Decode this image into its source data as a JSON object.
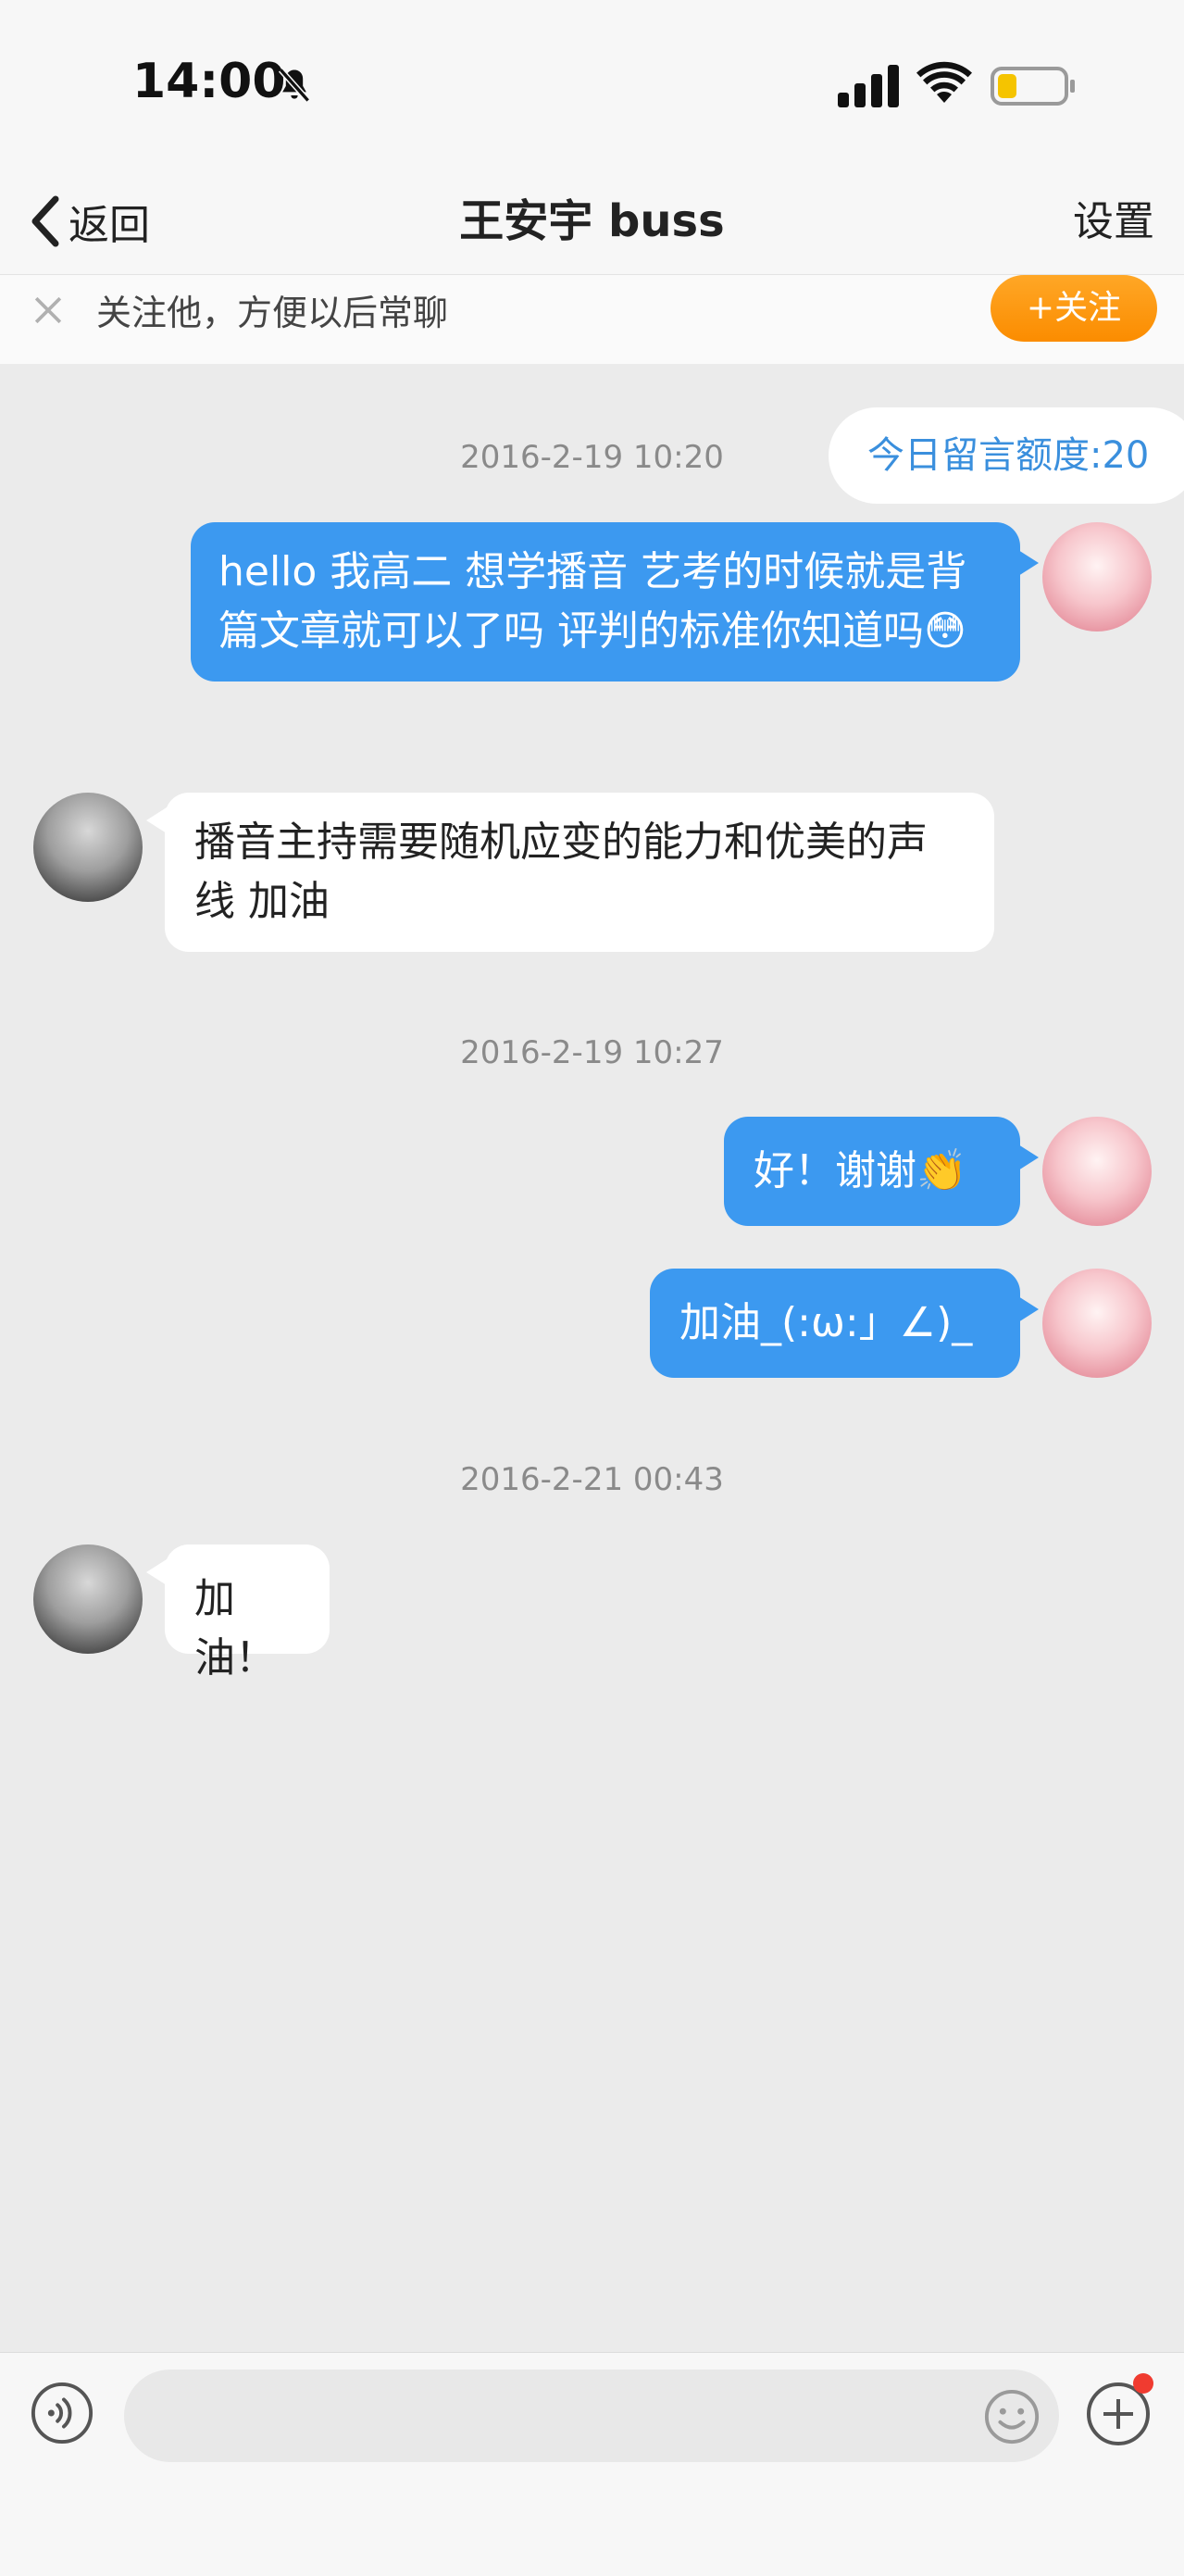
{
  "status_bar": {
    "time": "14:00"
  },
  "nav": {
    "back_label": "返回",
    "title": "王安宇 buss",
    "settings_label": "设置"
  },
  "follow_bar": {
    "text": "关注他，方便以后常聊",
    "button_label": "+关注"
  },
  "quota_label": "今日留言额度:20",
  "messages": [
    {
      "time": "2016-2-19 10:20"
    },
    {
      "text": "hello 我高二 想学播音 艺考的时候就是背篇文章就可以了吗 评判的标准你知道吗😳"
    },
    {
      "text": "播音主持需要随机应变的能力和优美的声线 加油"
    },
    {
      "time": "2016-2-19 10:27"
    },
    {
      "text": "好！谢谢👏"
    },
    {
      "text": "加油_(:ω:」∠)_"
    },
    {
      "time": "2016-2-21 00:43"
    },
    {
      "text": "加油！"
    }
  ],
  "input": {
    "placeholder": ""
  },
  "colors": {
    "outgoing_bubble": "#3c99f0",
    "incoming_bubble": "#ffffff",
    "follow_button": "#fb8c00",
    "quota_text": "#3a8fdd"
  }
}
